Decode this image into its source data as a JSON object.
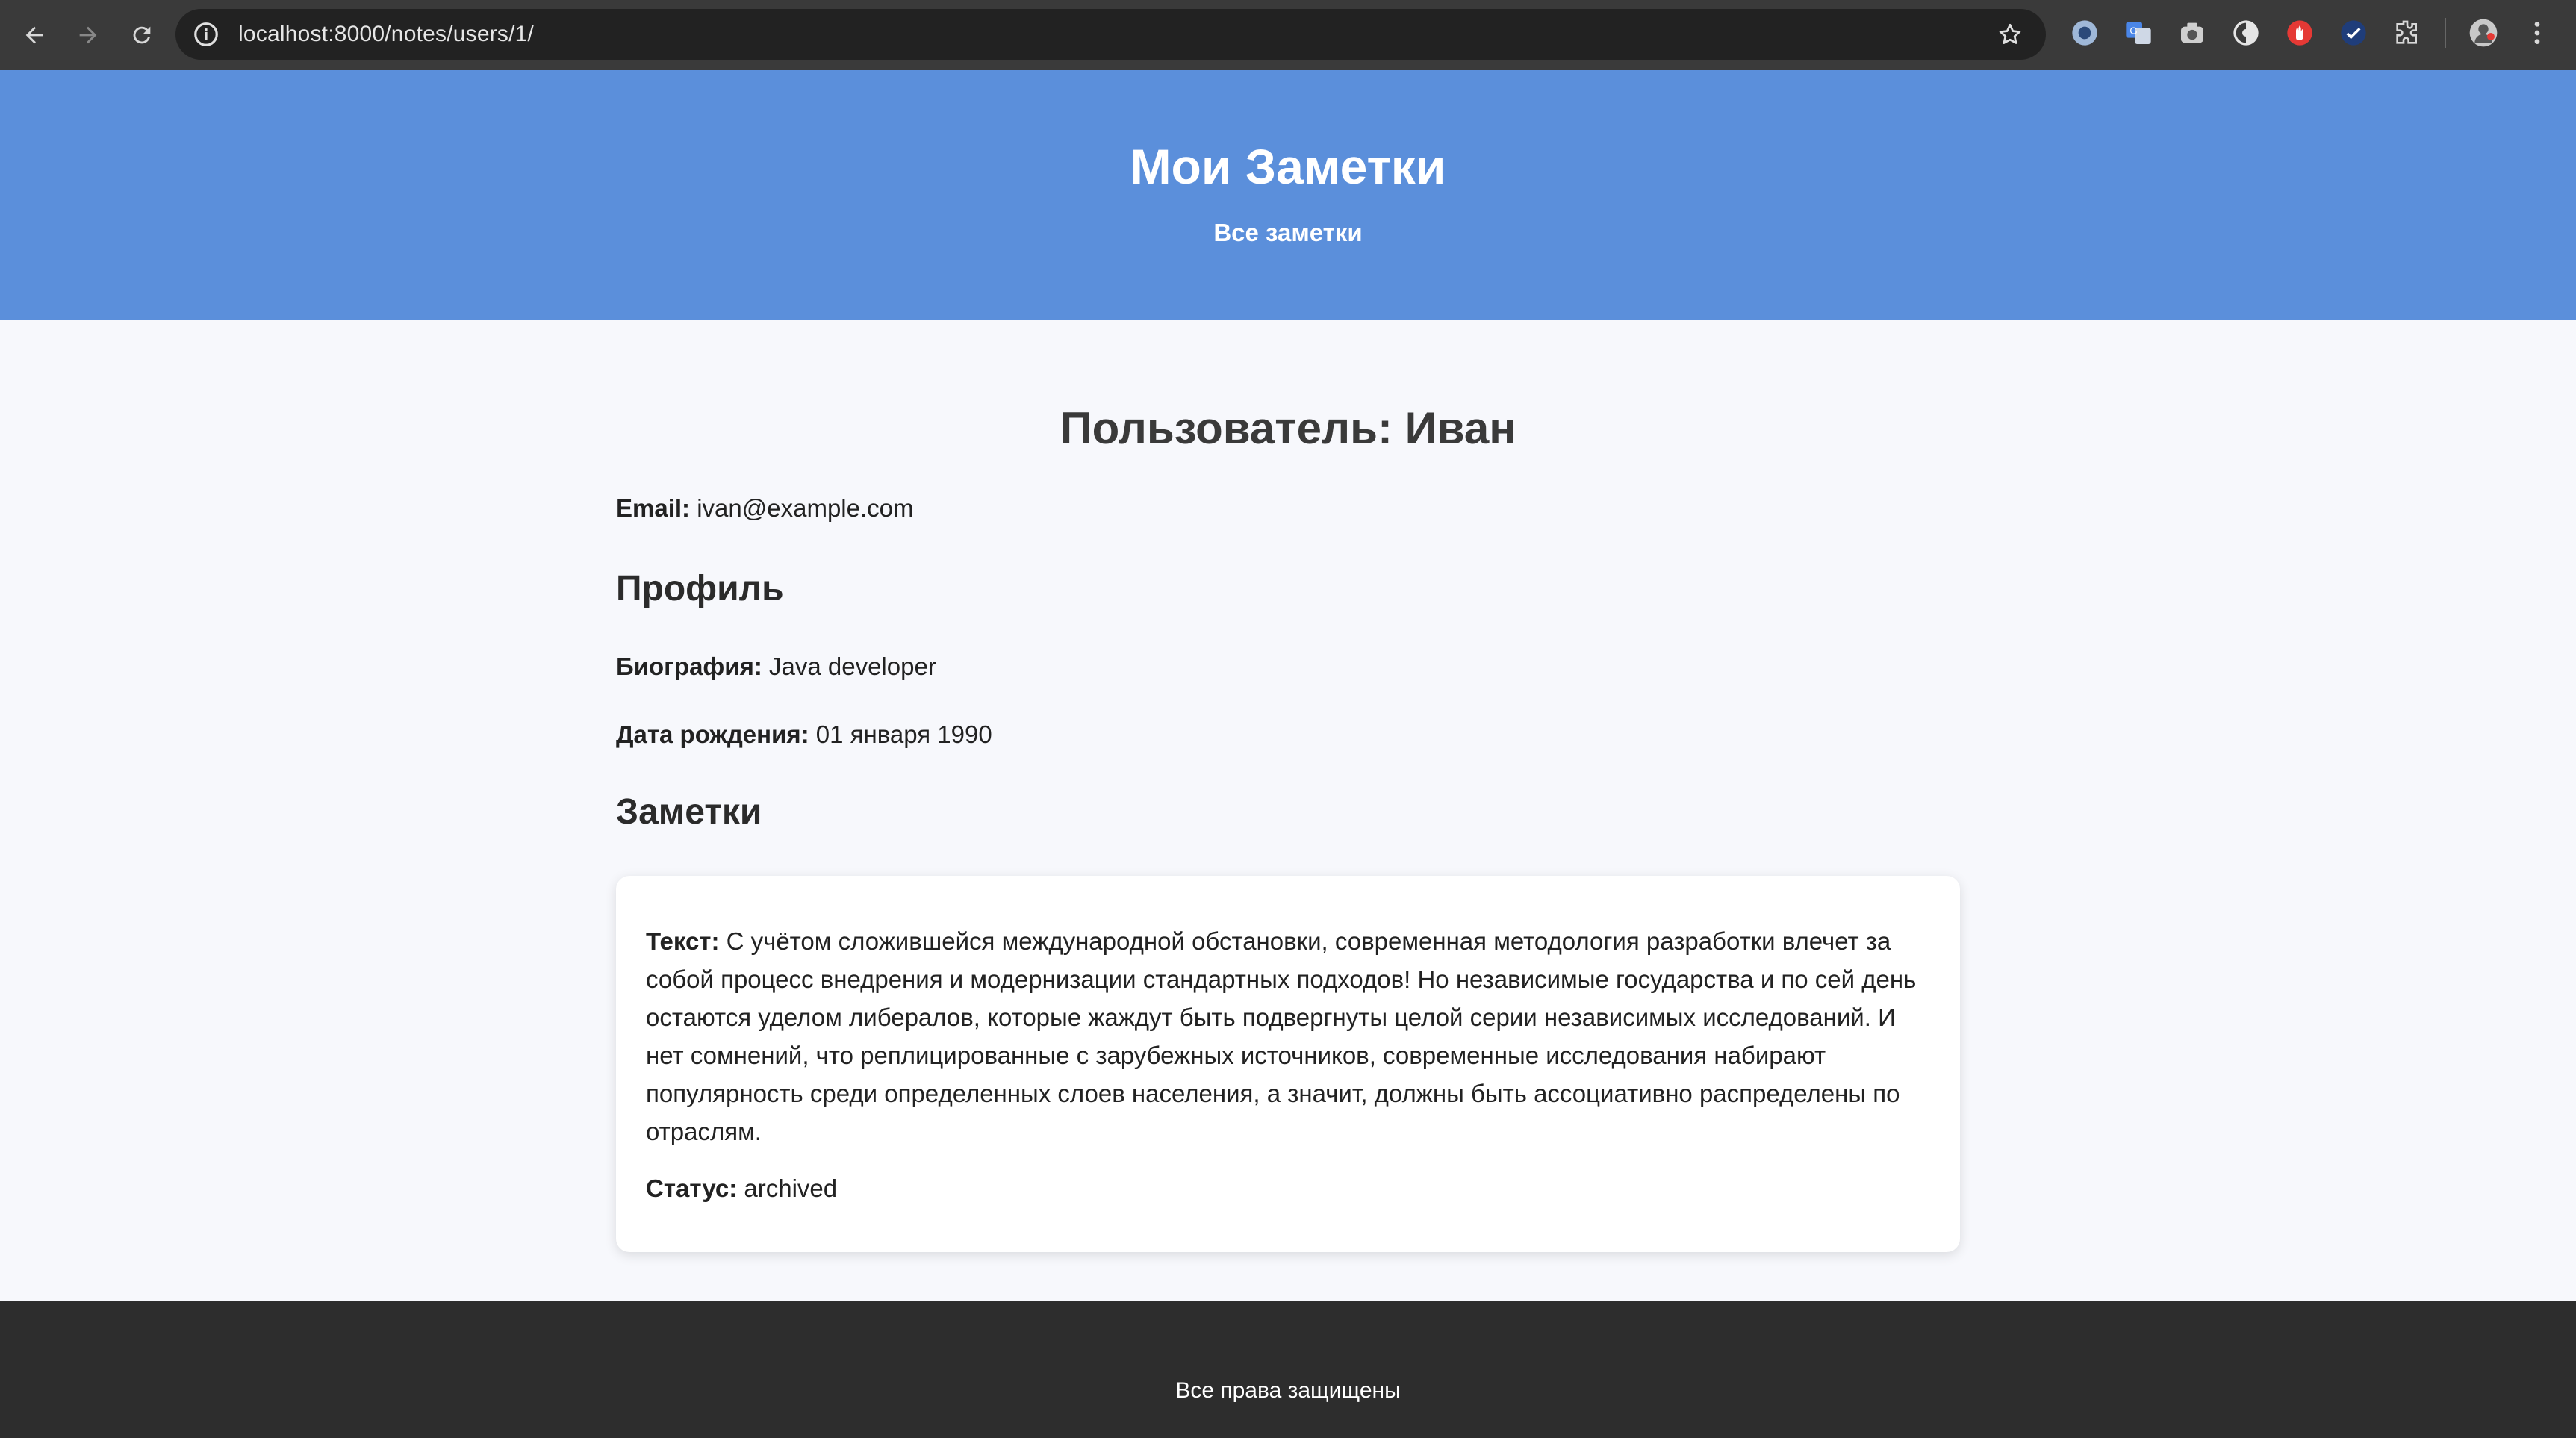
{
  "browser": {
    "url": "localhost:8000/notes/users/1/",
    "icons": [
      "back-arrow-icon",
      "forward-arrow-icon",
      "reload-icon",
      "site-info-icon",
      "bookmark-star-icon",
      "extensions-icon",
      "menu-kebab-icon"
    ]
  },
  "header": {
    "title": "Мои Заметки",
    "nav_all_notes": "Все заметки"
  },
  "user": {
    "title": "Пользователь: Иван",
    "email_label": "Email:",
    "email_value": "ivan@example.com"
  },
  "profile": {
    "heading": "Профиль",
    "bio_label": "Биография:",
    "bio_value": "Java developer",
    "birth_label": "Дата рождения:",
    "birth_value": "01 января 1990"
  },
  "notes": {
    "heading": "Заметки",
    "items": [
      {
        "text_label": "Текст:",
        "text_value": "С учётом сложившейся международной обстановки, современная методология разработки влечет за собой процесс внедрения и модернизации стандартных подходов! Но независимые государства и по сей день остаются уделом либералов, которые жаждут быть подвергнуты целой серии независимых исследований. И нет сомнений, что реплицированные с зарубежных источников, современные исследования набирают популярность среди определенных слоев населения, а значит, должны быть ассоциативно распределены по отраслям.",
        "status_label": "Статус:",
        "status_value": "archived"
      }
    ]
  },
  "footer": {
    "copyright": "Все права защищены"
  },
  "colors": {
    "header_bg": "#5b8fdb",
    "footer_bg": "#2d2d2d",
    "page_bg": "#f7f8fc"
  }
}
